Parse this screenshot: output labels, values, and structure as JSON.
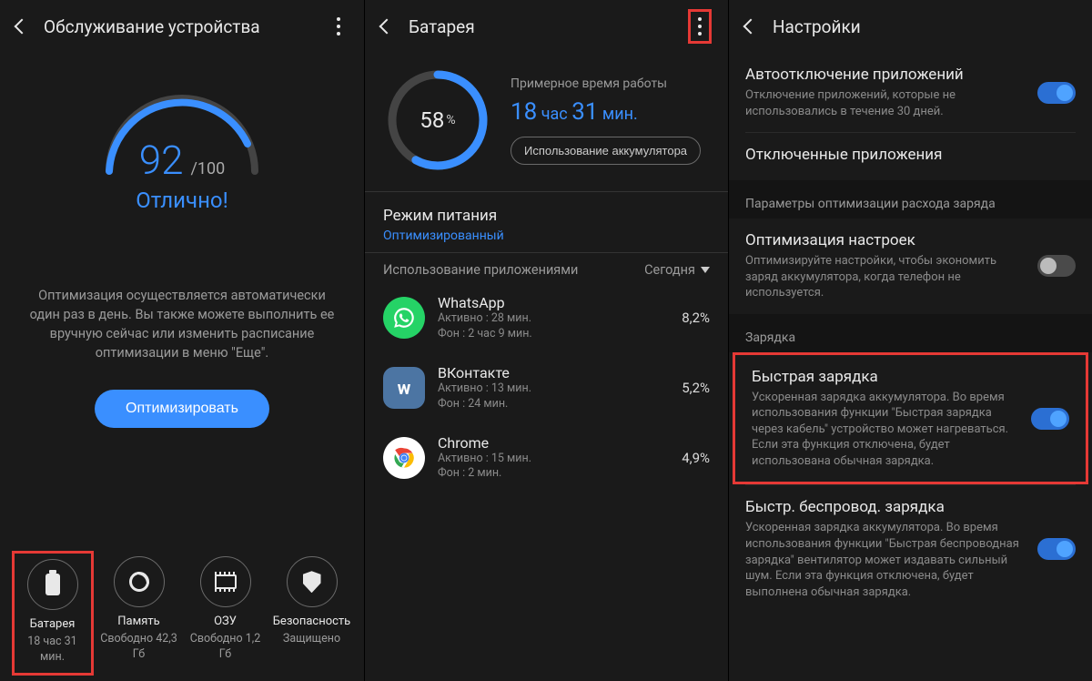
{
  "panel1": {
    "title": "Обслуживание устройства",
    "score": "92",
    "score_max": "/100",
    "score_label": "Отлично!",
    "desc": "Оптимизация осуществляется автоматически один раз в день. Вы также можете выполнить ее вручную сейчас или изменить расписание оптимизации в меню \"Еще\".",
    "optimize": "Оптимизировать",
    "tiles": [
      {
        "name": "Батарея",
        "sub": "18 час 31 мин."
      },
      {
        "name": "Память",
        "sub": "Свободно 42,3 Гб"
      },
      {
        "name": "ОЗУ",
        "sub": "Свободно 1,2 Гб"
      },
      {
        "name": "Безопасность",
        "sub": "Защищено"
      }
    ]
  },
  "panel2": {
    "title": "Батарея",
    "pct": "58",
    "est_label": "Примерное время работы",
    "est_h": "18",
    "est_h_unit": "час",
    "est_m": "31",
    "est_m_unit": "мин.",
    "usage_btn": "Использование аккумулятора",
    "mode_title": "Режим питания",
    "mode_value": "Оптимизированный",
    "usage_header": "Использование приложениями",
    "today": "Сегодня",
    "apps": [
      {
        "name": "WhatsApp",
        "active": "Активно : 28 мин.",
        "bg": "Фон : 2 час 9 мин.",
        "pct": "8,2%",
        "color": "#25D366",
        "glyph": "✆"
      },
      {
        "name": "ВКонтакте",
        "active": "Активно : 13 мин.",
        "bg": "Фон : 24 мин.",
        "pct": "5,2%",
        "color": "#4C75A3",
        "glyph": "w"
      },
      {
        "name": "Chrome",
        "active": "Активно : 15 мин.",
        "bg": "Фон : 2 мин.",
        "pct": "4,9%",
        "color": "#fff",
        "glyph": "◉"
      }
    ]
  },
  "panel3": {
    "title": "Настройки",
    "items": [
      {
        "title": "Автоотключение приложений",
        "desc": "Отключение приложений, которые не использовались в течение 30 дней.",
        "toggle": "on"
      },
      {
        "title": "Отключенные приложения",
        "desc": "",
        "toggle": ""
      }
    ],
    "group1": "Параметры оптимизации расхода заряда",
    "opt": {
      "title": "Оптимизация настроек",
      "desc": "Оптимизируйте настройки, чтобы экономить заряд аккумулятора, когда телефон не используется.",
      "toggle": "off"
    },
    "group2": "Зарядка",
    "fast": {
      "title": "Быстрая зарядка",
      "desc": "Ускоренная зарядка аккумулятора. Во время использования функции \"Быстрая зарядка через кабель\" устройство может нагреваться. Если эта функция отключена, будет использована обычная зарядка.",
      "toggle": "on"
    },
    "wireless": {
      "title": "Быстр. беспровод. зарядка",
      "desc": "Ускоренная зарядка аккумулятора. Во время использования функции \"Быстрая беспроводная зарядка\" вентилятор может издавать сильный шум. Если эта функция отключена, будет выполнена обычная зарядка.",
      "toggle": "on"
    }
  }
}
